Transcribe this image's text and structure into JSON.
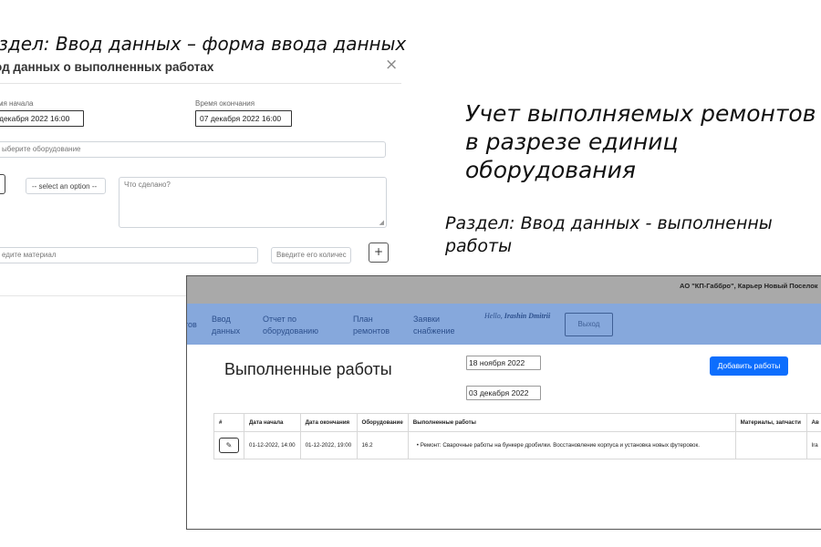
{
  "captions": {
    "top": "аздел: Ввод данных – форма ввода данных",
    "main": "Учет выполняемых ремонтов в разрезе единиц оборудования",
    "section_line1": "Раздел: Ввод данных - выполненны",
    "section_line2": "работы"
  },
  "modal": {
    "title": "од данных о выполненных работах",
    "close": "×",
    "start_label": "мя начала",
    "start_value": "декабря 2022 16:00",
    "end_label": "Время окончания",
    "end_value": "07 декабря 2022 16:00",
    "equipment_placeholder": "ыберите оборудование",
    "select_option": "-- select an option --",
    "done_placeholder": "Что сделано?",
    "material_placeholder": "едите материал",
    "qty_placeholder": "Введите его количес",
    "add_label": "+"
  },
  "app": {
    "company": "АО \"КП-Габбро\", Карьер Новый Поселок",
    "nav_clip": "тов",
    "nav": [
      {
        "line1": "Ввод",
        "line2": "данных"
      },
      {
        "line1": "Отчет по",
        "line2": "оборудованию"
      },
      {
        "line1": "План",
        "line2": "ремонтов"
      },
      {
        "line1": "Заявки",
        "line2": "снабжение"
      }
    ],
    "hello_prefix": "Hello, ",
    "hello_name": "Irashin Dmitrii",
    "logout": "Выход",
    "page_title": "Выполненные работы",
    "date_from": "18 ноября 2022",
    "date_to": "03 декабря 2022",
    "add_button": "Добавить работы",
    "table": {
      "headers": [
        "#",
        "Дата начала",
        "Дата окончания",
        "Оборудование",
        "Выполненные работы",
        "Материалы, запчасти",
        "Ав"
      ],
      "rows": [
        {
          "start": "01-12-2022, 14:00",
          "end": "01-12-2022, 19:00",
          "equipment": "16.2",
          "work": "Ремонт: Сварочные работы на бункере дробилки. Восстановление корпуса и установка новых футеровок.",
          "materials": "",
          "author": "Ira"
        }
      ]
    }
  }
}
